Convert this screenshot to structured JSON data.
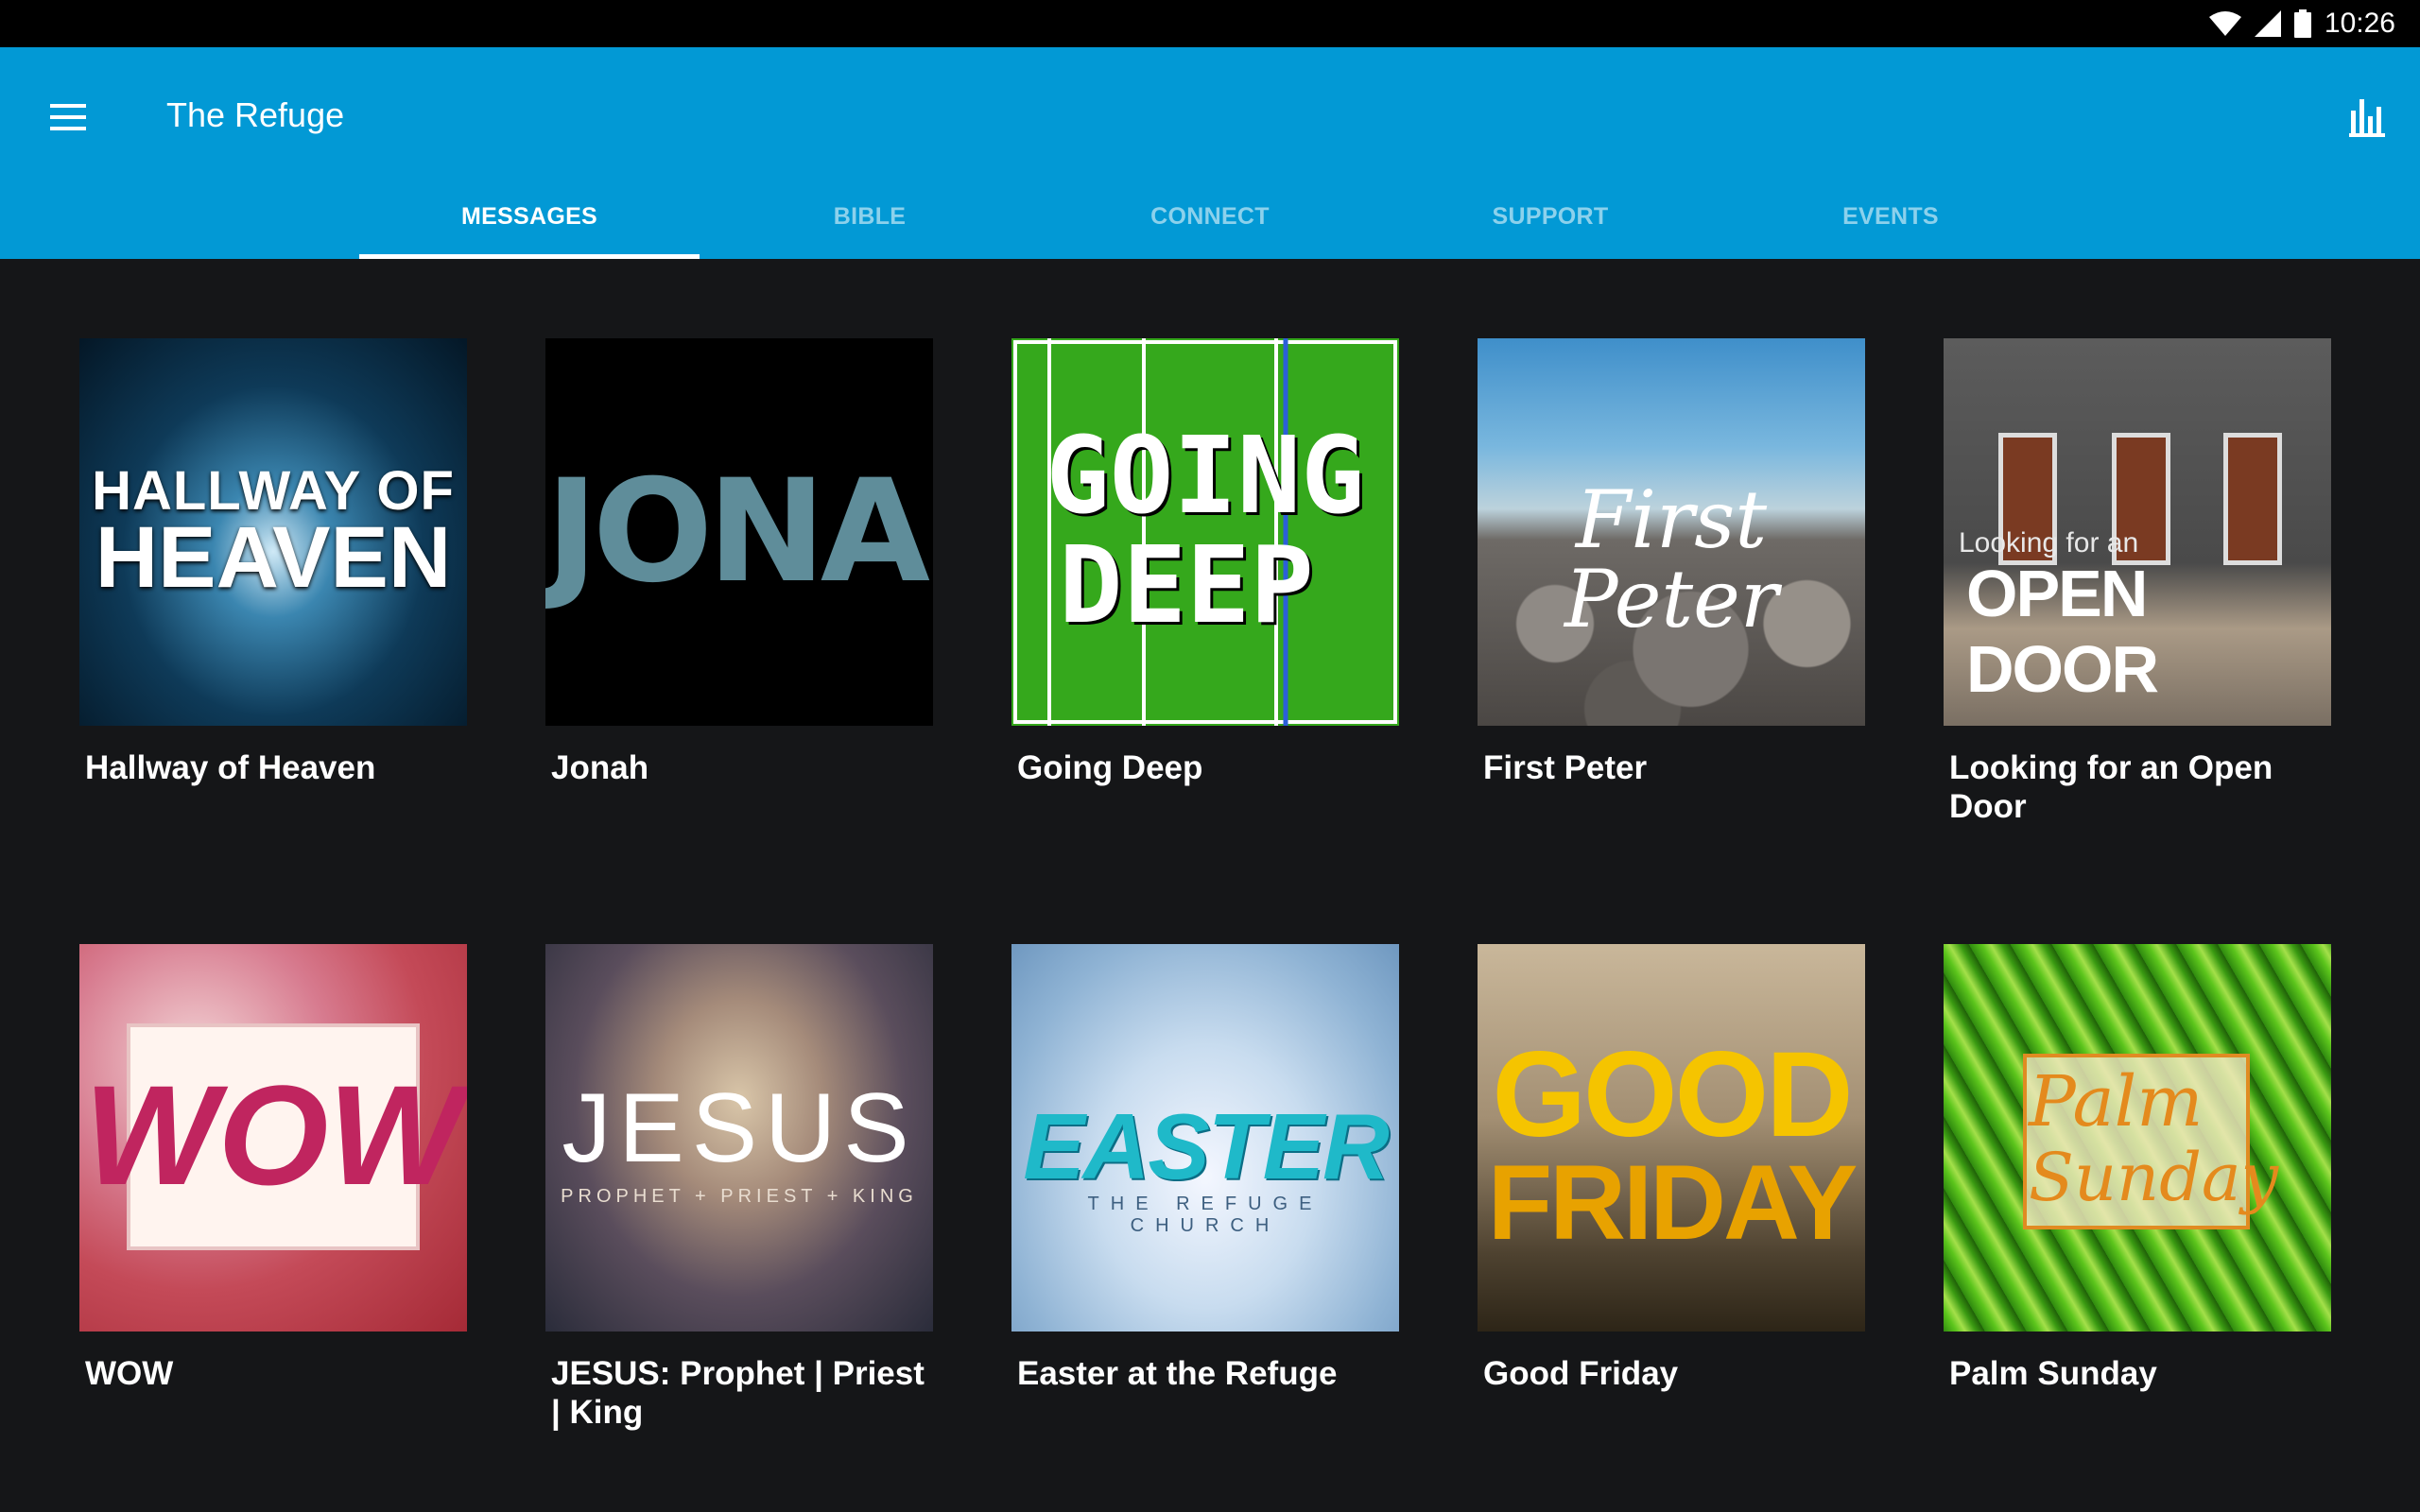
{
  "status_bar": {
    "time": "10:26",
    "icons": [
      "wifi-icon",
      "cell-signal-icon",
      "battery-icon"
    ]
  },
  "app_bar": {
    "title": "The Refuge",
    "menu_icon": "hamburger-menu-icon",
    "action_icon": "bar-chart-icon",
    "background_color": "#0299d5"
  },
  "tabs": [
    {
      "label": "MESSAGES",
      "active": true
    },
    {
      "label": "BIBLE",
      "active": false
    },
    {
      "label": "CONNECT",
      "active": false
    },
    {
      "label": "SUPPORT",
      "active": false
    },
    {
      "label": "EVENTS",
      "active": false
    }
  ],
  "messages": [
    {
      "title": "Hallway of Heaven",
      "artwork_text": [
        "HALLWAY OF",
        "HEAVEN"
      ]
    },
    {
      "title": "Jonah",
      "artwork_text": [
        "JONAH"
      ]
    },
    {
      "title": "Going Deep",
      "artwork_text": [
        "GOING",
        "DEEP"
      ]
    },
    {
      "title": "First Peter",
      "artwork_text": [
        "First Peter"
      ]
    },
    {
      "title": "Looking for an Open Door",
      "artwork_text": [
        "Looking for an",
        "OPEN DOOR"
      ]
    },
    {
      "title": "WOW",
      "artwork_text": [
        "WOW"
      ]
    },
    {
      "title": "JESUS: Prophet | Priest | King",
      "artwork_text": [
        "JESUS",
        "PROPHET + PRIEST + KING"
      ]
    },
    {
      "title": "Easter at the Refuge",
      "artwork_text": [
        "EASTER",
        "THE REFUGE CHURCH"
      ]
    },
    {
      "title": "Good Friday",
      "artwork_text": [
        "GOOD",
        "FRIDAY"
      ]
    },
    {
      "title": "Palm Sunday",
      "artwork_text": [
        "Palm",
        "Sunday"
      ]
    }
  ]
}
